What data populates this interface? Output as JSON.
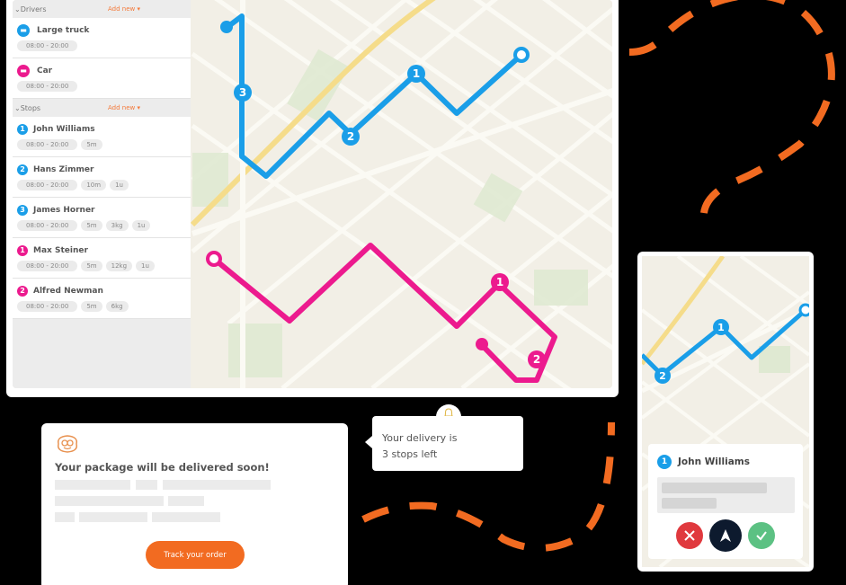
{
  "colors": {
    "blue_route": "#1a9ee8",
    "pink_route": "#ec1a8e",
    "orange": "#f26b21",
    "reject": "#e0393e",
    "navigate": "#0d1a2e",
    "accept": "#5cc183"
  },
  "sidebar": {
    "drivers_header": "Drivers",
    "drivers_add": "Add new",
    "drivers": [
      {
        "name": "Large truck",
        "color": "blue",
        "icon": "truck-icon",
        "time": "08:00 - 20:00"
      },
      {
        "name": "Car",
        "color": "pink",
        "icon": "car-icon",
        "time": "08:00 - 20:00"
      }
    ],
    "stops_header": "Stops",
    "stops_add": "Add new",
    "stops": [
      {
        "num": "1",
        "color": "blue",
        "name": "John Williams",
        "time": "08:00 - 20:00",
        "chips": [
          "5m"
        ]
      },
      {
        "num": "2",
        "color": "blue",
        "name": "Hans Zimmer",
        "time": "08:00 - 20:00",
        "chips": [
          "10m",
          "1u"
        ]
      },
      {
        "num": "3",
        "color": "blue",
        "name": "James Horner",
        "time": "08:00 - 20:00",
        "chips": [
          "5m",
          "3kg",
          "1u"
        ]
      },
      {
        "num": "1",
        "color": "pink",
        "name": "Max Steiner",
        "time": "08:00 - 20:00",
        "chips": [
          "5m",
          "12kg",
          "1u"
        ]
      },
      {
        "num": "2",
        "color": "pink",
        "name": "Alfred Newman",
        "time": "08:00 - 20:00",
        "chips": [
          "5m",
          "6kg"
        ]
      }
    ]
  },
  "map": {
    "blue_markers": [
      "1",
      "2",
      "3"
    ],
    "pink_markers": [
      "1",
      "2"
    ]
  },
  "notification": {
    "logo": "monkey-logo-icon",
    "title": "Your package will be delivered soon!",
    "button": "Track your order"
  },
  "tooltip": {
    "icon": "bell-icon",
    "line1": "Your delivery is",
    "line2": "3 stops left"
  },
  "phone": {
    "stop_num": "1",
    "stop_name": "John Williams",
    "markers": [
      "1",
      "2"
    ],
    "actions": [
      "reject",
      "navigate",
      "accept"
    ]
  }
}
